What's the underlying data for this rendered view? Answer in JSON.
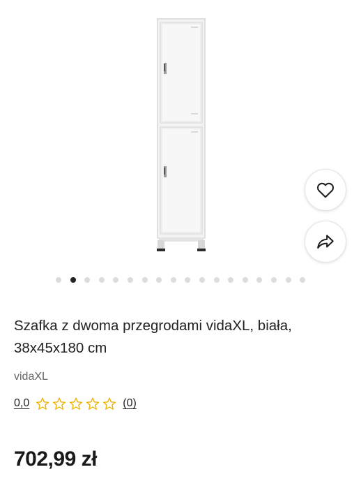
{
  "product": {
    "title": "Szafka z dwoma przegrodami vidaXL, biała, 38x45x180 cm",
    "brand": "vidaXL",
    "rating": {
      "value_label": "0,0",
      "stars_filled": 0,
      "stars_total": 5,
      "review_count_label": "(0)"
    },
    "price": "702,99 zł"
  },
  "gallery": {
    "image_count": 18,
    "active_index": 1
  },
  "icons": {
    "favorite": "heart-icon",
    "share": "share-icon",
    "rating_star": "star-outline-icon"
  },
  "colors": {
    "star": "#f0b400",
    "dot_active": "#222222",
    "dot_inactive": "#dcdcdc"
  }
}
